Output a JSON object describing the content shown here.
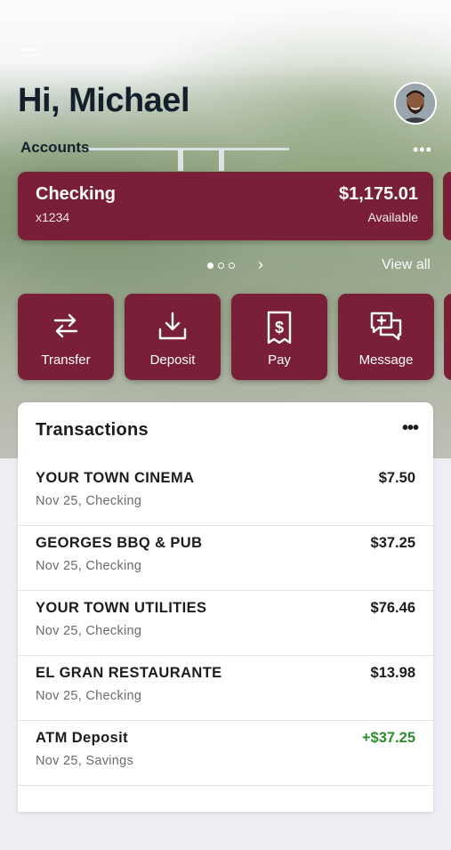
{
  "header": {
    "greeting": "Hi, Michael",
    "accounts_label": "Accounts",
    "avatar_icon": "avatar-photo",
    "menu_icon": "hamburger-menu-icon",
    "more_icon": "ellipsis-icon"
  },
  "account_card": {
    "name": "Checking",
    "number": "x1234",
    "balance": "$1,175.01",
    "balance_label": "Available",
    "color": "#7a1f38"
  },
  "pager": {
    "pages": 3,
    "active_index": 0,
    "view_all_label": "View all"
  },
  "actions": [
    {
      "label": "Transfer",
      "icon": "transfer-arrows-icon"
    },
    {
      "label": "Deposit",
      "icon": "deposit-tray-icon"
    },
    {
      "label": "Pay",
      "icon": "bill-dollar-icon"
    },
    {
      "label": "Message",
      "icon": "message-plus-icon"
    }
  ],
  "transactions": {
    "title": "Transactions",
    "more_icon": "ellipsis-icon",
    "items": [
      {
        "merchant": "YOUR TOWN CINEMA",
        "meta": "Nov 25, Checking",
        "amount": "$7.50",
        "positive": false
      },
      {
        "merchant": "GEORGES BBQ & PUB",
        "meta": "Nov 25, Checking",
        "amount": "$37.25",
        "positive": false
      },
      {
        "merchant": "YOUR TOWN UTILITIES",
        "meta": "Nov 25, Checking",
        "amount": "$76.46",
        "positive": false
      },
      {
        "merchant": "EL GRAN RESTAURANTE",
        "meta": "Nov 25, Checking",
        "amount": "$13.98",
        "positive": false
      },
      {
        "merchant": "ATM Deposit",
        "meta": "Nov 25, Savings",
        "amount": "+$37.25",
        "positive": true
      }
    ]
  },
  "colors": {
    "brand": "#7a1f38",
    "positive": "#2e8b2e"
  }
}
